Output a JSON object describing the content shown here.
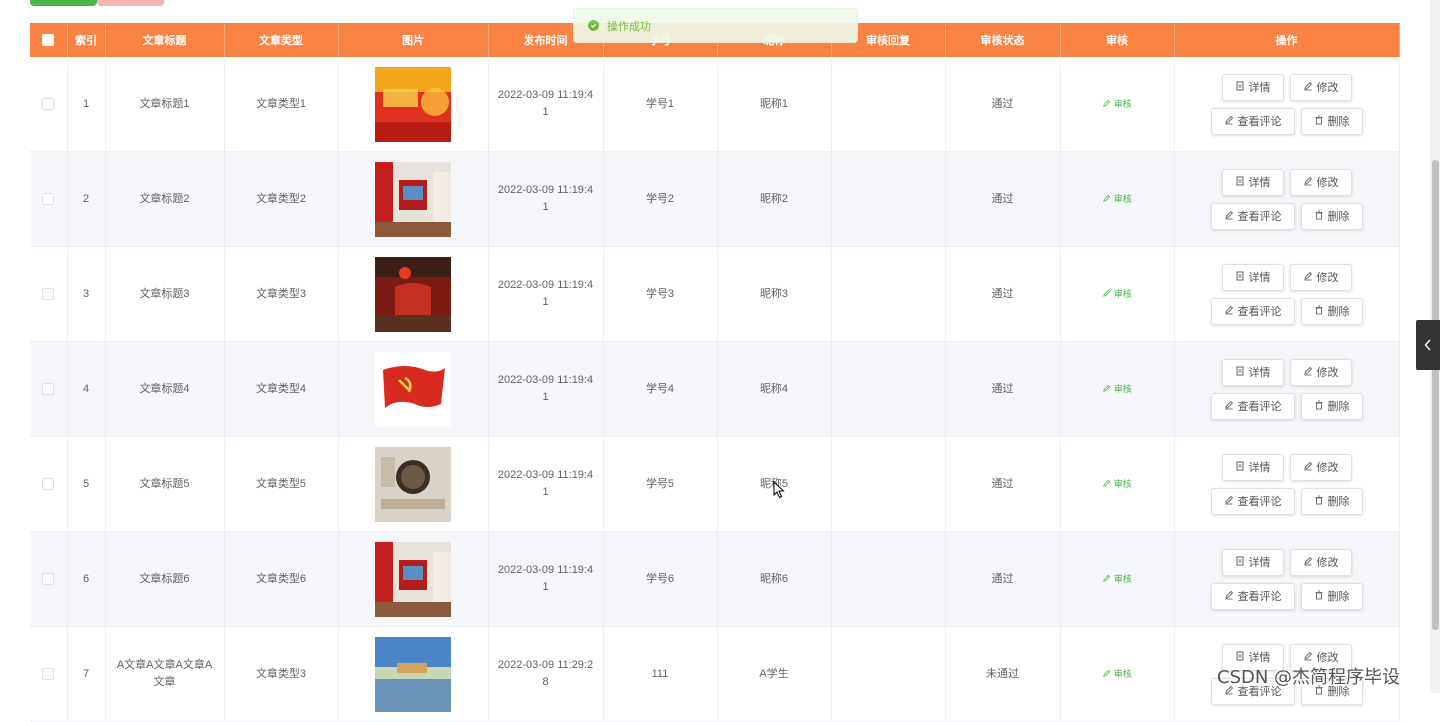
{
  "toolbar": {
    "add_button": "",
    "delete_button": ""
  },
  "toast": {
    "message": "操作成功"
  },
  "table": {
    "headers": [
      "",
      "索引",
      "文章标题",
      "文章类型",
      "图片",
      "发布时间",
      "学号",
      "昵称",
      "审核回复",
      "审核状态",
      "审核",
      "操作"
    ],
    "audit_label": "审核",
    "actions": {
      "detail": "详情",
      "edit": "修改",
      "comments": "查看评论",
      "delete": "删除"
    },
    "rows": [
      {
        "index": "1",
        "title": "文章标题1",
        "type": "文章类型1",
        "time": "2022-03-09 11:19:41",
        "student_id": "学号1",
        "nickname": "昵称1",
        "reply": "",
        "status": "通过",
        "image": "flag-banner"
      },
      {
        "index": "2",
        "title": "文章标题2",
        "type": "文章类型2",
        "time": "2022-03-09 11:19:41",
        "student_id": "学号2",
        "nickname": "昵称2",
        "reply": "",
        "status": "通过",
        "image": "exhibition-hall"
      },
      {
        "index": "3",
        "title": "文章标题3",
        "type": "文章类型3",
        "time": "2022-03-09 11:19:41",
        "student_id": "学号3",
        "nickname": "昵称3",
        "reply": "",
        "status": "通过",
        "image": "red-room"
      },
      {
        "index": "4",
        "title": "文章标题4",
        "type": "文章类型4",
        "time": "2022-03-09 11:19:41",
        "student_id": "学号4",
        "nickname": "昵称4",
        "reply": "",
        "status": "通过",
        "image": "party-flag"
      },
      {
        "index": "5",
        "title": "文章标题5",
        "type": "文章类型5",
        "time": "2022-03-09 11:19:41",
        "student_id": "学号5",
        "nickname": "昵称5",
        "reply": "",
        "status": "通过",
        "image": "wall-plaque"
      },
      {
        "index": "6",
        "title": "文章标题6",
        "type": "文章类型6",
        "time": "2022-03-09 11:19:41",
        "student_id": "学号6",
        "nickname": "昵称6",
        "reply": "",
        "status": "通过",
        "image": "exhibition-hall"
      },
      {
        "index": "7",
        "title": "A文章A文章A文章A文章",
        "type": "文章类型3",
        "time": "2022-03-09 11:29:28",
        "student_id": "111",
        "nickname": "A学生",
        "reply": "",
        "status": "未通过",
        "image": "river-landscape"
      }
    ]
  },
  "watermark": "CSDN @杰简程序毕设",
  "colors": {
    "header": "#fa8344",
    "success": "#4bb749",
    "toast_bg": "#f0f9eb"
  }
}
